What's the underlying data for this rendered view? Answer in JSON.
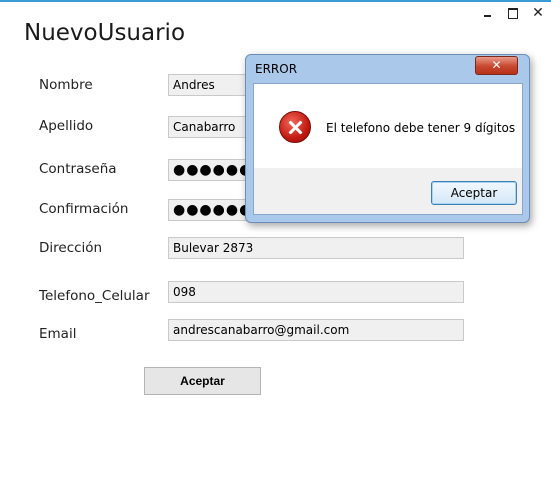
{
  "window": {
    "title": "NuevoUsuario",
    "controls": {
      "minimize_icon": "minimize-icon",
      "maximize_icon": "maximize-icon",
      "close_icon": "close-icon",
      "close_glyph": "✕"
    },
    "accent_color": "#3a9bd5"
  },
  "form": {
    "fields": [
      {
        "label": "Nombre",
        "value": "Andres"
      },
      {
        "label": "Apellido",
        "value": "Canabarro"
      },
      {
        "label": "Contraseña",
        "value": "●●●●●●●●"
      },
      {
        "label": "Confirmación",
        "value": "●●●●●●●●"
      },
      {
        "label": "Dirección",
        "value": "Bulevar 2873"
      },
      {
        "label": "Telefono_Celular",
        "value": "098"
      },
      {
        "label": "Email",
        "value": "andrescanabarro@gmail.com"
      }
    ],
    "submit_label": "Aceptar"
  },
  "dialog": {
    "title": "ERROR",
    "close_glyph": "✕",
    "icon": "error-icon",
    "message": "El telefono debe tener 9 dígitos",
    "button_label": "Aceptar"
  }
}
